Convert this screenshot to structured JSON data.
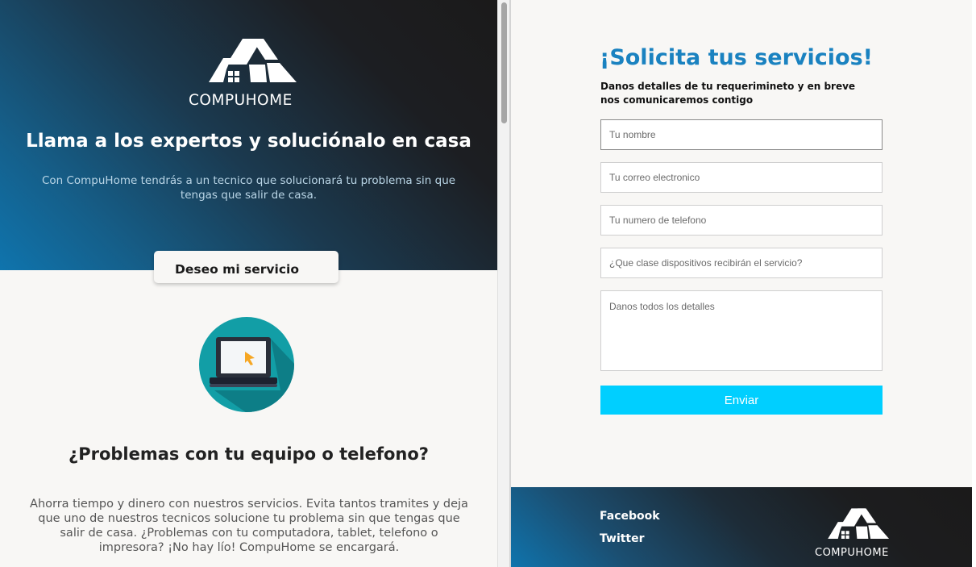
{
  "brand": {
    "name": "COMPUHOME"
  },
  "hero": {
    "title": "Llama a los expertos y soluciónalo en casa",
    "subtitle": "Con CompuHome tendrás a un tecnico que solucionará tu problema sin que tengas que salir de casa.",
    "cta_label": "Deseo mi servicio"
  },
  "section": {
    "icon": "laptop-icon",
    "title": "¿Problemas con tu equipo o telefono?",
    "body": "Ahorra tiempo y dinero con nuestros servicios. Evita tantos tramites y deja que uno de nuestros tecnicos solucione tu problema sin que tengas que salir de casa. ¿Problemas con tu computadora, tablet, telefono o impresora? ¡No hay lío! CompuHome se encargará."
  },
  "form": {
    "title": "¡Solicita tus servicios!",
    "subtitle": "Danos detalles de tu requerimineto y en breve nos comunicaremos contigo",
    "fields": {
      "name_placeholder": "Tu nombre",
      "email_placeholder": "Tu correo electronico",
      "phone_placeholder": "Tu numero de telefono",
      "device_placeholder": "¿Que clase dispositivos recibirán el servicio?",
      "details_placeholder": "Danos todos los detalles"
    },
    "submit_label": "Enviar"
  },
  "footer": {
    "links": [
      "Facebook",
      "Twitter"
    ]
  },
  "colors": {
    "accent_title": "#1a82c0",
    "submit_button": "#00cfff",
    "hero_gradient_start": "#0f74ad",
    "hero_gradient_end": "#1b1a1a",
    "page_background": "#f8f7f5"
  }
}
